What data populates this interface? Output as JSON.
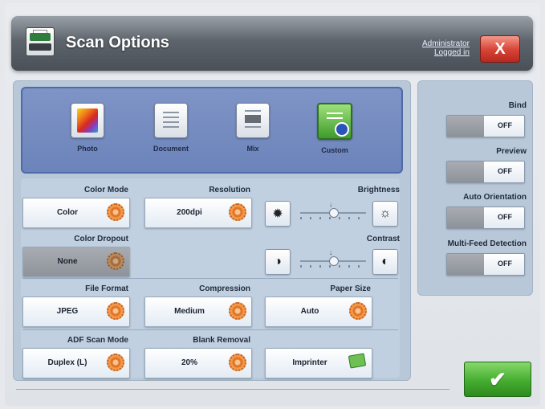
{
  "header": {
    "title": "Scan Options",
    "admin_line1": "Administrator",
    "admin_line2": "Logged in",
    "close_label": "X"
  },
  "modes": [
    {
      "label": "Photo",
      "icon": "photo-icon"
    },
    {
      "label": "Document",
      "icon": "document-icon"
    },
    {
      "label": "Mix",
      "icon": "mix-icon"
    },
    {
      "label": "Custom",
      "icon": "custom-icon",
      "selected": true
    }
  ],
  "settings": {
    "color_mode": {
      "label": "Color Mode",
      "value": "Color"
    },
    "resolution": {
      "label": "Resolution",
      "value": "200dpi"
    },
    "brightness": {
      "label": "Brightness",
      "level": 0.5
    },
    "color_dropout": {
      "label": "Color Dropout",
      "value": "None"
    },
    "contrast": {
      "label": "Contrast",
      "level": 0.5
    },
    "file_format": {
      "label": "File Format",
      "value": "JPEG"
    },
    "compression": {
      "label": "Compression",
      "value": "Medium"
    },
    "paper_size": {
      "label": "Paper Size",
      "value": "Auto"
    },
    "adf_scan_mode": {
      "label": "ADF Scan Mode",
      "value": "Duplex (L)"
    },
    "blank_removal": {
      "label": "Blank Removal",
      "value": "20%"
    },
    "imprinter": {
      "value": "Imprinter"
    }
  },
  "toggles": {
    "bind": {
      "label": "Bind",
      "state": "OFF"
    },
    "preview": {
      "label": "Preview",
      "state": "OFF"
    },
    "auto_orientation": {
      "label": "Auto Orientation",
      "state": "OFF"
    },
    "multi_feed": {
      "label": "Multi-Feed Detection",
      "state": "OFF"
    }
  },
  "ok_label": "✔",
  "colors": {
    "accent_green": "#45ad30",
    "close_red": "#d9473a",
    "mode_panel": "#6c84bb"
  }
}
